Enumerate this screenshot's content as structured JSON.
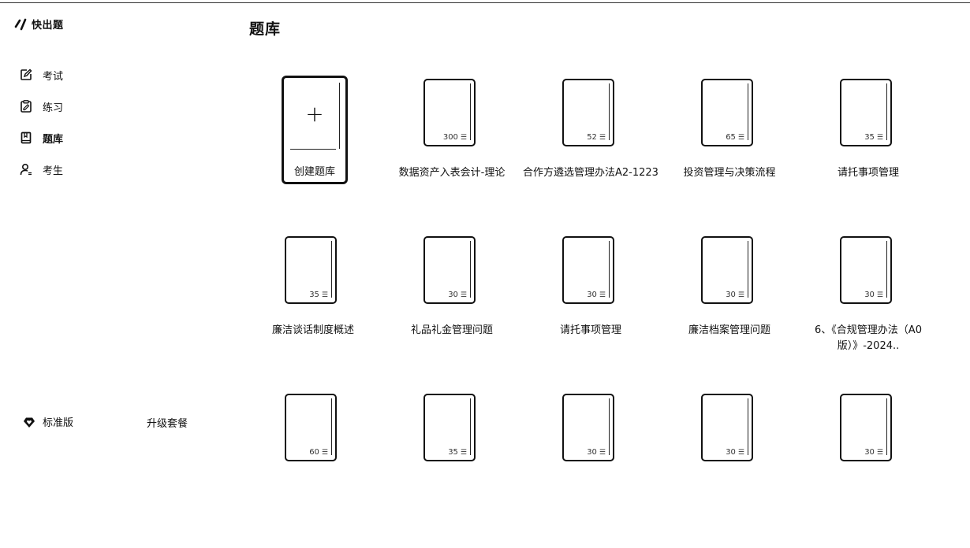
{
  "app": {
    "name": "快出题"
  },
  "sidebar": {
    "items": [
      {
        "label": "考试",
        "icon": "edit-icon"
      },
      {
        "label": "练习",
        "icon": "practice-icon"
      },
      {
        "label": "题库",
        "icon": "book-icon",
        "active": true
      },
      {
        "label": "考生",
        "icon": "user-icon"
      }
    ],
    "plan": {
      "label": "标准版",
      "icon": "diamond-heart-icon"
    },
    "upgrade_label": "升级套餐"
  },
  "main": {
    "title": "题库",
    "create_label": "创建题库",
    "create_symbol": "+",
    "count_unit_icon": "question-list-icon",
    "banks": [
      {
        "name": "数据资产入表会计-理论",
        "count": "300"
      },
      {
        "name": "合作方遴选管理办法A2-1223",
        "count": "52"
      },
      {
        "name": "投资管理与决策流程",
        "count": "65"
      },
      {
        "name": "请托事项管理",
        "count": "35"
      },
      {
        "name": "廉洁谈话制度概述",
        "count": "35"
      },
      {
        "name": "礼品礼金管理问题",
        "count": "30"
      },
      {
        "name": "请托事项管理",
        "count": "30"
      },
      {
        "name": "廉洁档案管理问题",
        "count": "30"
      },
      {
        "name": "6、《合规管理办法（A0版）》-2024..",
        "count": "30"
      },
      {
        "name": "",
        "count": "60"
      },
      {
        "name": "",
        "count": "35"
      },
      {
        "name": "",
        "count": "30"
      },
      {
        "name": "",
        "count": "30"
      },
      {
        "name": "",
        "count": "30"
      }
    ]
  }
}
